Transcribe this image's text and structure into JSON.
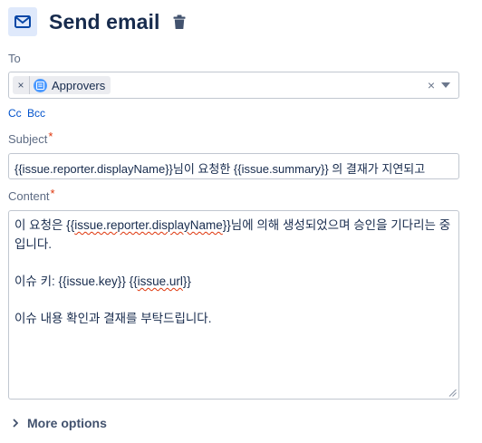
{
  "header": {
    "title": "Send email"
  },
  "to": {
    "label": "To",
    "chips": [
      {
        "remove": "×",
        "label": "Approvers"
      }
    ],
    "clear": "×"
  },
  "cc_bcc": {
    "cc": "Cc",
    "bcc": "Bcc"
  },
  "subject": {
    "label": "Subject",
    "required_mark": "*",
    "value_parts": [
      "{{issue.reporter.displayName}}님이 요청한 {{issue.summary}} 의 결재가 지연되고"
    ]
  },
  "content": {
    "label": "Content",
    "required_mark": "*",
    "line1_pre": "이 요청은 {{",
    "line1_var": "issue.reporter.displayName",
    "line1_post": "}}님에 의해 생성되었으며 승인을 기다리는 중입니다.",
    "line2_pre": "이슈 키: {{issue.key}} {{",
    "line2_var": "issue.url",
    "line2_post": "}}",
    "line3": "이슈 내용 확인과 결재를 부탁드립니다."
  },
  "more_options": {
    "label": "More options"
  },
  "colors": {
    "accent": "#0052cc",
    "required": "#de350b",
    "icon_tile": "#dfe9fb",
    "chip_avatar": "#4c9aff"
  }
}
